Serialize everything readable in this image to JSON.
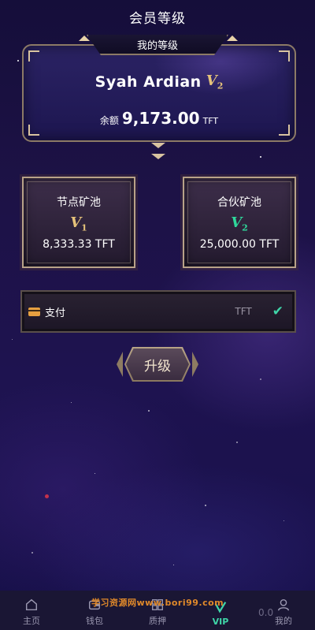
{
  "header": {
    "title": "会员等级"
  },
  "level_card": {
    "tab_label": "我的等级",
    "user_name": "Syah Ardian",
    "vip_letter": "V",
    "vip_level": "2",
    "balance_label": "余额",
    "balance_value": "9,173.00",
    "balance_unit": "TFT"
  },
  "pools": [
    {
      "title": "节点矿池",
      "badge_letter": "V",
      "badge_level": "1",
      "value": "8,333.33 TFT",
      "badge_color": "#e5c27a"
    },
    {
      "title": "合伙矿池",
      "badge_letter": "V",
      "badge_level": "2",
      "value": "25,000.00 TFT",
      "badge_color": "#2fd89b"
    }
  ],
  "payment": {
    "label": "支付",
    "unit": "TFT",
    "selected": true
  },
  "upgrade_button": {
    "label": "升级"
  },
  "bottom_nav": [
    {
      "label": "主页",
      "icon": "home-icon",
      "active": false
    },
    {
      "label": "钱包",
      "icon": "wallet-icon",
      "active": false
    },
    {
      "label": "质押",
      "icon": "stake-icon",
      "active": false
    },
    {
      "label": "VIP",
      "icon": "vip-icon",
      "active": true
    },
    {
      "label": "我的",
      "icon": "user-icon",
      "active": false
    }
  ],
  "overlay": {
    "watermark": "学习资源网www.bori99.com",
    "timer": "0.0"
  },
  "colors": {
    "accent_green": "#3fd5a8",
    "gold": "#e5c27a",
    "frame": "#b8a288",
    "background": "#1d1246"
  }
}
